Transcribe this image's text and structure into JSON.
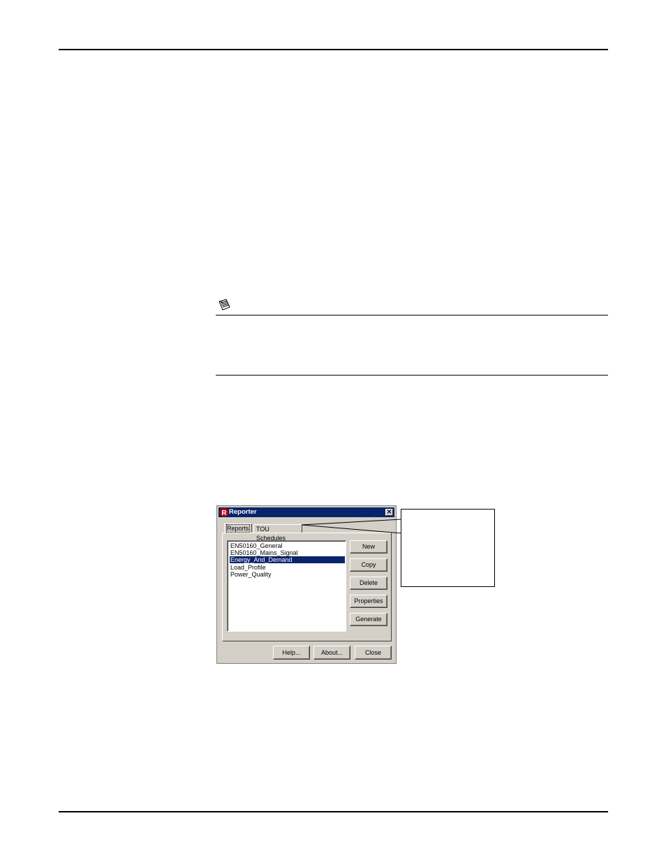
{
  "dialog": {
    "title": "Reporter",
    "close_glyph": "×",
    "tabs": [
      {
        "label": "Reports",
        "active": true
      },
      {
        "label": "TOU Schedules",
        "active": false
      }
    ],
    "reports": [
      {
        "label": "EN50160_General",
        "selected": false
      },
      {
        "label": "EN50160_Mains_Signal",
        "selected": false
      },
      {
        "label": "Energy_And_Demand",
        "selected": true
      },
      {
        "label": "Load_Profile",
        "selected": false
      },
      {
        "label": "Power_Quality",
        "selected": false
      }
    ],
    "side_buttons": [
      "New",
      "Copy",
      "Delete",
      "Properties",
      "Generate"
    ],
    "bottom_buttons": [
      "Help...",
      "About...",
      "Close"
    ]
  },
  "icons": {
    "note": "note-pad-icon",
    "app": "reporter-app-icon"
  },
  "colors": {
    "titlebar": "#0a246a",
    "dialog_face": "#d4d0c8",
    "selection": "#0a246a"
  }
}
